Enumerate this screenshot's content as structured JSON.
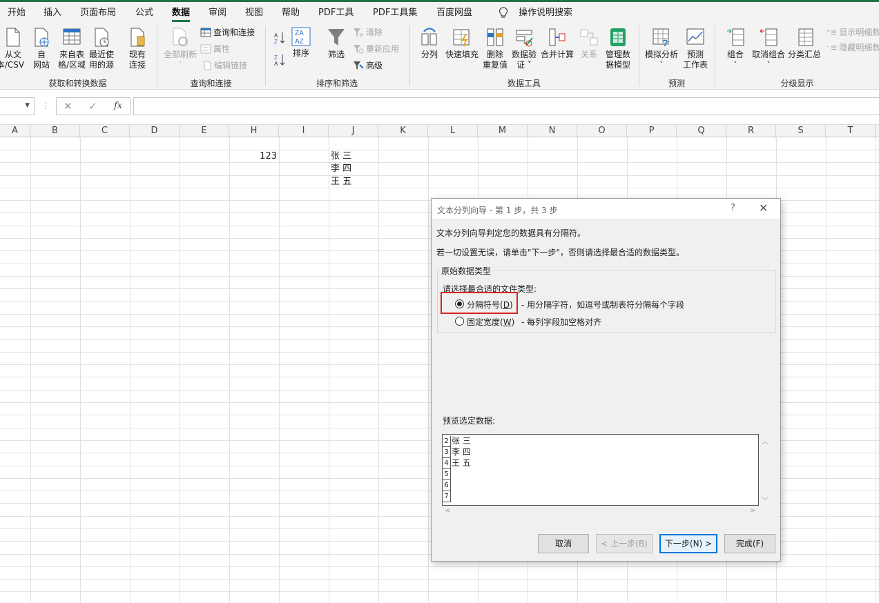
{
  "menu": {
    "tabs": [
      "开始",
      "插入",
      "页面布局",
      "公式",
      "数据",
      "审阅",
      "视图",
      "帮助",
      "PDF工具",
      "PDF工具集",
      "百度网盘"
    ],
    "active_tab": "数据",
    "tell_me": "操作说明搜索"
  },
  "ribbon": {
    "groups": {
      "get_transform": "获取和转换数据",
      "queries": "查询和连接",
      "sort_filter": "排序和筛选",
      "data_tools": "数据工具",
      "forecast": "预测",
      "outline": "分级显示"
    },
    "buttons": {
      "from_text": [
        "从文",
        "本/CSV"
      ],
      "from_web": [
        "自",
        "网站"
      ],
      "from_table": [
        "来自表",
        "格/区域"
      ],
      "recent_sources": [
        "最近使",
        "用的源"
      ],
      "existing": [
        "现有",
        "连接"
      ],
      "refresh_all": "全部刷新",
      "queries_connections": "查询和连接",
      "properties": "属性",
      "edit_links": "编辑链接",
      "sort": "排序",
      "filter": "筛选",
      "clear": "清除",
      "reapply": "重新应用",
      "advanced": "高级",
      "text_to_columns": "分列",
      "flash_fill": "快速填充",
      "remove_duplicates": [
        "删除",
        "重复值"
      ],
      "data_validation": [
        "数据验",
        "证 ˅"
      ],
      "consolidate": "合并计算",
      "relationships": "关系",
      "manage_model": [
        "管理数",
        "据模型"
      ],
      "what_if": [
        "模拟分析",
        "˅"
      ],
      "forecast_sheet": [
        "预测",
        "工作表"
      ],
      "group": [
        "组合",
        "˅"
      ],
      "ungroup": [
        "取消组合",
        "˅"
      ],
      "subtotal": "分类汇总",
      "show_detail": "显示明细数",
      "hide_detail": "隐藏明细数"
    }
  },
  "formula_bar": {
    "cancel": "✕",
    "enter": "✓",
    "fx": "fx",
    "value": ""
  },
  "columns": [
    "A",
    "B",
    "C",
    "D",
    "E",
    "H",
    "I",
    "J",
    "K",
    "L",
    "M",
    "N",
    "O",
    "P",
    "Q",
    "R",
    "S",
    "T"
  ],
  "cells": {
    "h_row1": "123",
    "j_row1": "张 三",
    "j_row2": "李 四",
    "j_row3": "王 五"
  },
  "dialog": {
    "title": "文本分列向导 - 第 1 步，共 3 步",
    "help": "?",
    "close": "✕",
    "line1": "文本分列向导判定您的数据具有分隔符。",
    "line2": "若一切设置无误，请单击\"下一步\"，否则请选择最合适的数据类型。",
    "group_title": "原始数据类型",
    "choose_label": "请选择最合适的文件类型:",
    "options": [
      {
        "label": "分隔符号(",
        "key": "D",
        "desc": "- 用分隔字符，如逗号或制表符分隔每个字段",
        "selected": true
      },
      {
        "label": "固定宽度(",
        "key": "W",
        "desc": "- 每列字段加空格对齐",
        "selected": false
      }
    ],
    "preview_label": "预览选定数据:",
    "preview_rows": [
      {
        "num": "2",
        "text": "张 三"
      },
      {
        "num": "3",
        "text": "李 四"
      },
      {
        "num": "4",
        "text": "王 五"
      },
      {
        "num": "5",
        "text": ""
      },
      {
        "num": "6",
        "text": ""
      },
      {
        "num": "7",
        "text": ""
      }
    ],
    "buttons": {
      "cancel": "取消",
      "back": "< 上一步(B)",
      "next": "下一步(N) >",
      "finish": "完成(F)"
    }
  }
}
